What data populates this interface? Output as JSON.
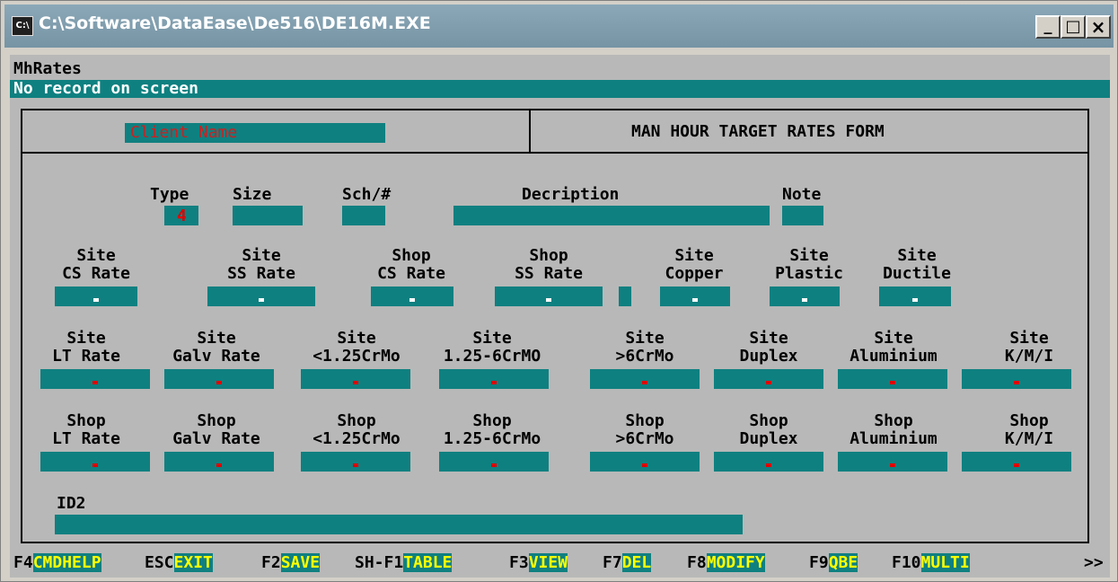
{
  "window": {
    "title": "C:\\Software\\DataEase\\De516\\DE16M.EXE",
    "icon": "console-icon",
    "buttons": {
      "minimize": "_",
      "maximize": "□",
      "close": "×"
    }
  },
  "screen": {
    "form_name": "MhRates",
    "status": "No record on screen"
  },
  "header": {
    "client_placeholder": "Client Name",
    "form_title": "MAN HOUR TARGET RATES FORM"
  },
  "row1": {
    "type_label": "Type",
    "type_value": "4",
    "size_label": "Size",
    "sch_label": "Sch/#",
    "description_label": "Decription",
    "note_label": "Note"
  },
  "row2": [
    {
      "top": "Site",
      "bottom": "CS Rate"
    },
    {
      "top": "Site",
      "bottom": "SS Rate"
    },
    {
      "top": "Shop",
      "bottom": "CS Rate"
    },
    {
      "top": "Shop",
      "bottom": "SS Rate"
    },
    {
      "top": "Site",
      "bottom": "Copper"
    },
    {
      "top": "Site",
      "bottom": "Plastic"
    },
    {
      "top": "Site",
      "bottom": "Ductile"
    }
  ],
  "row3": [
    {
      "top": "Site",
      "bottom": "LT Rate"
    },
    {
      "top": "Site",
      "bottom": "Galv Rate"
    },
    {
      "top": "Site",
      "bottom": "<1.25CrMo"
    },
    {
      "top": "Site",
      "bottom": "1.25-6CrMO"
    },
    {
      "top": "Site",
      "bottom": ">6CrMo"
    },
    {
      "top": "Site",
      "bottom": "Duplex"
    },
    {
      "top": "Site",
      "bottom": "Aluminium"
    },
    {
      "top": "Site",
      "bottom": "K/M/I"
    }
  ],
  "row4": [
    {
      "top": "Shop",
      "bottom": "LT Rate"
    },
    {
      "top": "Shop",
      "bottom": "Galv Rate"
    },
    {
      "top": "Shop",
      "bottom": "<1.25CrMo"
    },
    {
      "top": "Shop",
      "bottom": "1.25-6CrMo"
    },
    {
      "top": "Shop",
      "bottom": ">6CrMo"
    },
    {
      "top": "Shop",
      "bottom": "Duplex"
    },
    {
      "top": "Shop",
      "bottom": "Aluminium"
    },
    {
      "top": "Shop",
      "bottom": "K/M/I"
    }
  ],
  "id2_label": "ID2",
  "fkeys": [
    {
      "key": "F4",
      "label": "CMDHELP"
    },
    {
      "key": "ESC",
      "label": "EXIT"
    },
    {
      "key": "F2",
      "label": "SAVE"
    },
    {
      "key": "SH-F1",
      "label": "TABLE"
    },
    {
      "key": "F3",
      "label": "VIEW"
    },
    {
      "key": "F7",
      "label": "DEL"
    },
    {
      "key": "F8",
      "label": "MODIFY"
    },
    {
      "key": "F9",
      "label": "QBE"
    },
    {
      "key": "F10",
      "label": "MULTI"
    }
  ],
  "more_indicator": ">>",
  "colors": {
    "field": "#0f8080",
    "label_red": "#e00000",
    "fkey_text": "#ffff00",
    "background": "#b8b8b8"
  }
}
